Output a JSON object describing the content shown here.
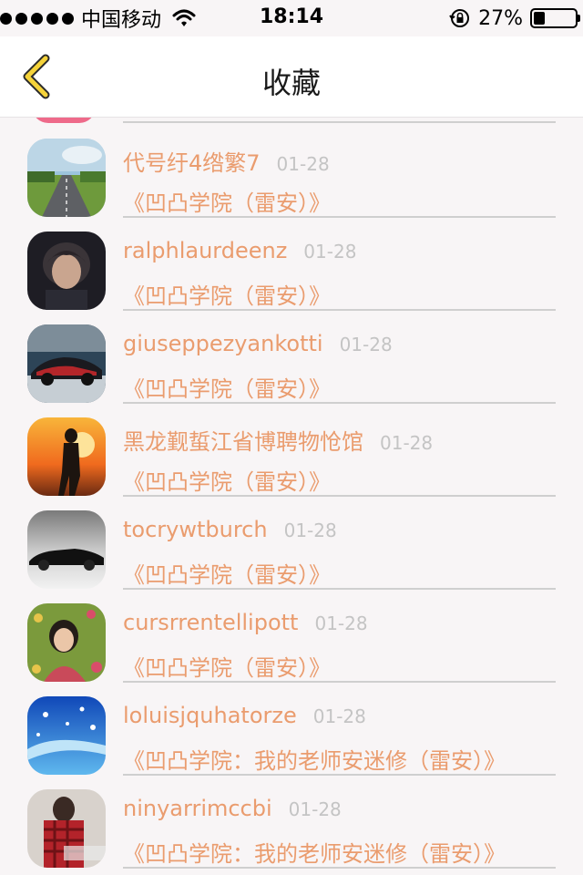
{
  "status_bar": {
    "carrier": "中国移动",
    "time": "18:14",
    "battery": "27%",
    "icons": [
      "signal-dots-icon",
      "wifi-icon",
      "rotation-lock-icon",
      "battery-icon"
    ]
  },
  "nav": {
    "title": "收藏",
    "back_icon": "chevron-left-icon",
    "accent": "#f5d33a"
  },
  "colors": {
    "username": "#ea9c6e",
    "date": "#c4c4c4",
    "title": "#ea9c6e",
    "background": "#f8f5f6"
  },
  "items": [
    {
      "username": "代号纡4绺繁7",
      "date": "01-28",
      "title": "《凹凸学院（雷安）》",
      "avatar_icon": "road-landscape-avatar"
    },
    {
      "username": "ralphlaurdeenz",
      "date": "01-28",
      "title": "《凹凸学院（雷安）》",
      "avatar_icon": "portrait-avatar"
    },
    {
      "username": "giuseppezyankotti",
      "date": "01-28",
      "title": "《凹凸学院（雷安）》",
      "avatar_icon": "sports-car-avatar"
    },
    {
      "username": "黑龙觐蜇江省博聘物怆馆",
      "date": "01-28",
      "title": "《凹凸学院（雷安）》",
      "avatar_icon": "sunset-silhouette-avatar"
    },
    {
      "username": "tocrywtburch",
      "date": "01-28",
      "title": "《凹凸学院（雷安）》",
      "avatar_icon": "classic-car-avatar"
    },
    {
      "username": "cursrrentellipott",
      "date": "01-28",
      "title": "《凹凸学院（雷安）》",
      "avatar_icon": "girl-flowers-avatar"
    },
    {
      "username": "loluisjquhatorze",
      "date": "01-28",
      "title": "《凹凸学院：我的老师安迷修（雷安）》",
      "avatar_icon": "blue-snowflake-avatar"
    },
    {
      "username": "ninyarrimccbi",
      "date": "01-28",
      "title": "《凹凸学院：我的老师安迷修（雷安）》",
      "avatar_icon": "red-plaid-avatar"
    }
  ]
}
